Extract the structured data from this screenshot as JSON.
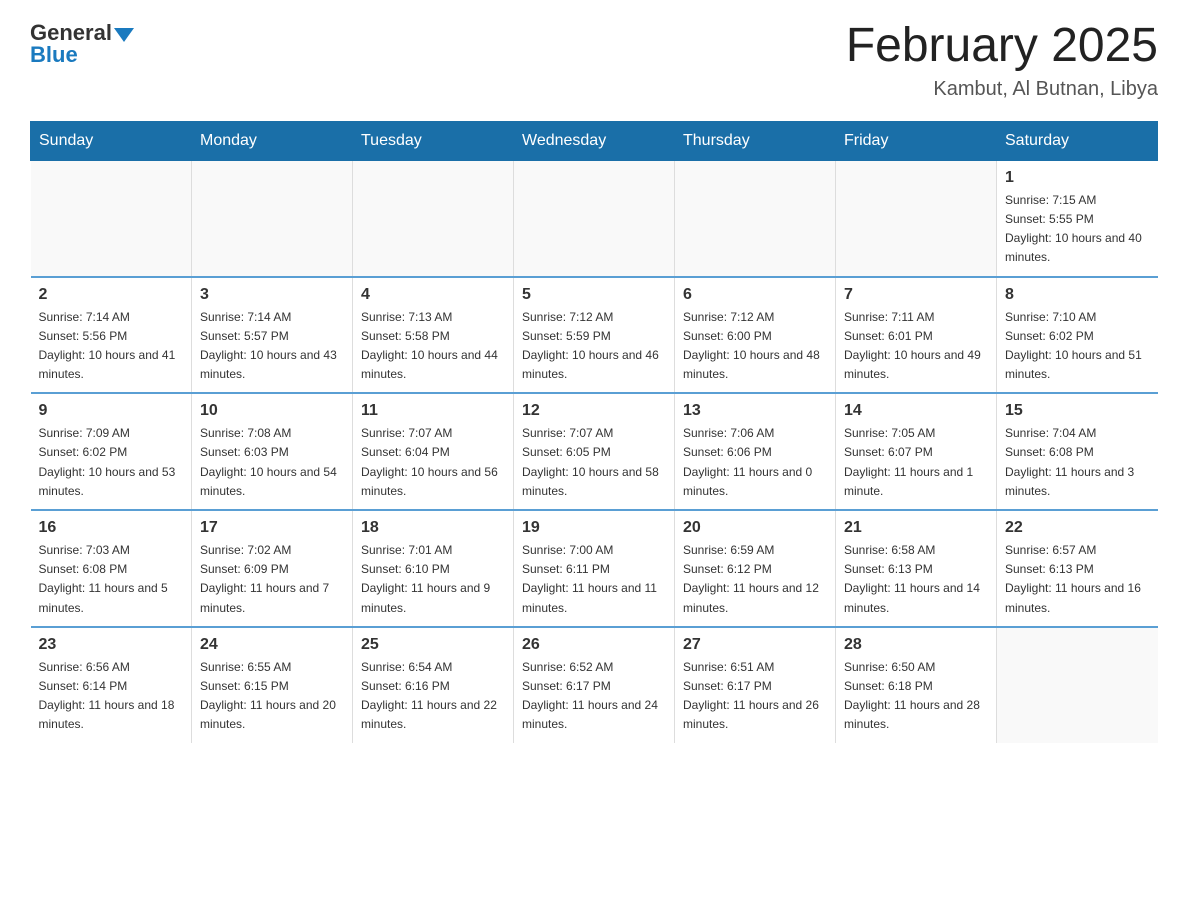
{
  "header": {
    "logo_general": "General",
    "logo_blue": "Blue",
    "title": "February 2025",
    "location": "Kambut, Al Butnan, Libya"
  },
  "days_of_week": [
    "Sunday",
    "Monday",
    "Tuesday",
    "Wednesday",
    "Thursday",
    "Friday",
    "Saturday"
  ],
  "weeks": [
    [
      {
        "day": "",
        "info": ""
      },
      {
        "day": "",
        "info": ""
      },
      {
        "day": "",
        "info": ""
      },
      {
        "day": "",
        "info": ""
      },
      {
        "day": "",
        "info": ""
      },
      {
        "day": "",
        "info": ""
      },
      {
        "day": "1",
        "info": "Sunrise: 7:15 AM\nSunset: 5:55 PM\nDaylight: 10 hours and 40 minutes."
      }
    ],
    [
      {
        "day": "2",
        "info": "Sunrise: 7:14 AM\nSunset: 5:56 PM\nDaylight: 10 hours and 41 minutes."
      },
      {
        "day": "3",
        "info": "Sunrise: 7:14 AM\nSunset: 5:57 PM\nDaylight: 10 hours and 43 minutes."
      },
      {
        "day": "4",
        "info": "Sunrise: 7:13 AM\nSunset: 5:58 PM\nDaylight: 10 hours and 44 minutes."
      },
      {
        "day": "5",
        "info": "Sunrise: 7:12 AM\nSunset: 5:59 PM\nDaylight: 10 hours and 46 minutes."
      },
      {
        "day": "6",
        "info": "Sunrise: 7:12 AM\nSunset: 6:00 PM\nDaylight: 10 hours and 48 minutes."
      },
      {
        "day": "7",
        "info": "Sunrise: 7:11 AM\nSunset: 6:01 PM\nDaylight: 10 hours and 49 minutes."
      },
      {
        "day": "8",
        "info": "Sunrise: 7:10 AM\nSunset: 6:02 PM\nDaylight: 10 hours and 51 minutes."
      }
    ],
    [
      {
        "day": "9",
        "info": "Sunrise: 7:09 AM\nSunset: 6:02 PM\nDaylight: 10 hours and 53 minutes."
      },
      {
        "day": "10",
        "info": "Sunrise: 7:08 AM\nSunset: 6:03 PM\nDaylight: 10 hours and 54 minutes."
      },
      {
        "day": "11",
        "info": "Sunrise: 7:07 AM\nSunset: 6:04 PM\nDaylight: 10 hours and 56 minutes."
      },
      {
        "day": "12",
        "info": "Sunrise: 7:07 AM\nSunset: 6:05 PM\nDaylight: 10 hours and 58 minutes."
      },
      {
        "day": "13",
        "info": "Sunrise: 7:06 AM\nSunset: 6:06 PM\nDaylight: 11 hours and 0 minutes."
      },
      {
        "day": "14",
        "info": "Sunrise: 7:05 AM\nSunset: 6:07 PM\nDaylight: 11 hours and 1 minute."
      },
      {
        "day": "15",
        "info": "Sunrise: 7:04 AM\nSunset: 6:08 PM\nDaylight: 11 hours and 3 minutes."
      }
    ],
    [
      {
        "day": "16",
        "info": "Sunrise: 7:03 AM\nSunset: 6:08 PM\nDaylight: 11 hours and 5 minutes."
      },
      {
        "day": "17",
        "info": "Sunrise: 7:02 AM\nSunset: 6:09 PM\nDaylight: 11 hours and 7 minutes."
      },
      {
        "day": "18",
        "info": "Sunrise: 7:01 AM\nSunset: 6:10 PM\nDaylight: 11 hours and 9 minutes."
      },
      {
        "day": "19",
        "info": "Sunrise: 7:00 AM\nSunset: 6:11 PM\nDaylight: 11 hours and 11 minutes."
      },
      {
        "day": "20",
        "info": "Sunrise: 6:59 AM\nSunset: 6:12 PM\nDaylight: 11 hours and 12 minutes."
      },
      {
        "day": "21",
        "info": "Sunrise: 6:58 AM\nSunset: 6:13 PM\nDaylight: 11 hours and 14 minutes."
      },
      {
        "day": "22",
        "info": "Sunrise: 6:57 AM\nSunset: 6:13 PM\nDaylight: 11 hours and 16 minutes."
      }
    ],
    [
      {
        "day": "23",
        "info": "Sunrise: 6:56 AM\nSunset: 6:14 PM\nDaylight: 11 hours and 18 minutes."
      },
      {
        "day": "24",
        "info": "Sunrise: 6:55 AM\nSunset: 6:15 PM\nDaylight: 11 hours and 20 minutes."
      },
      {
        "day": "25",
        "info": "Sunrise: 6:54 AM\nSunset: 6:16 PM\nDaylight: 11 hours and 22 minutes."
      },
      {
        "day": "26",
        "info": "Sunrise: 6:52 AM\nSunset: 6:17 PM\nDaylight: 11 hours and 24 minutes."
      },
      {
        "day": "27",
        "info": "Sunrise: 6:51 AM\nSunset: 6:17 PM\nDaylight: 11 hours and 26 minutes."
      },
      {
        "day": "28",
        "info": "Sunrise: 6:50 AM\nSunset: 6:18 PM\nDaylight: 11 hours and 28 minutes."
      },
      {
        "day": "",
        "info": ""
      }
    ]
  ]
}
